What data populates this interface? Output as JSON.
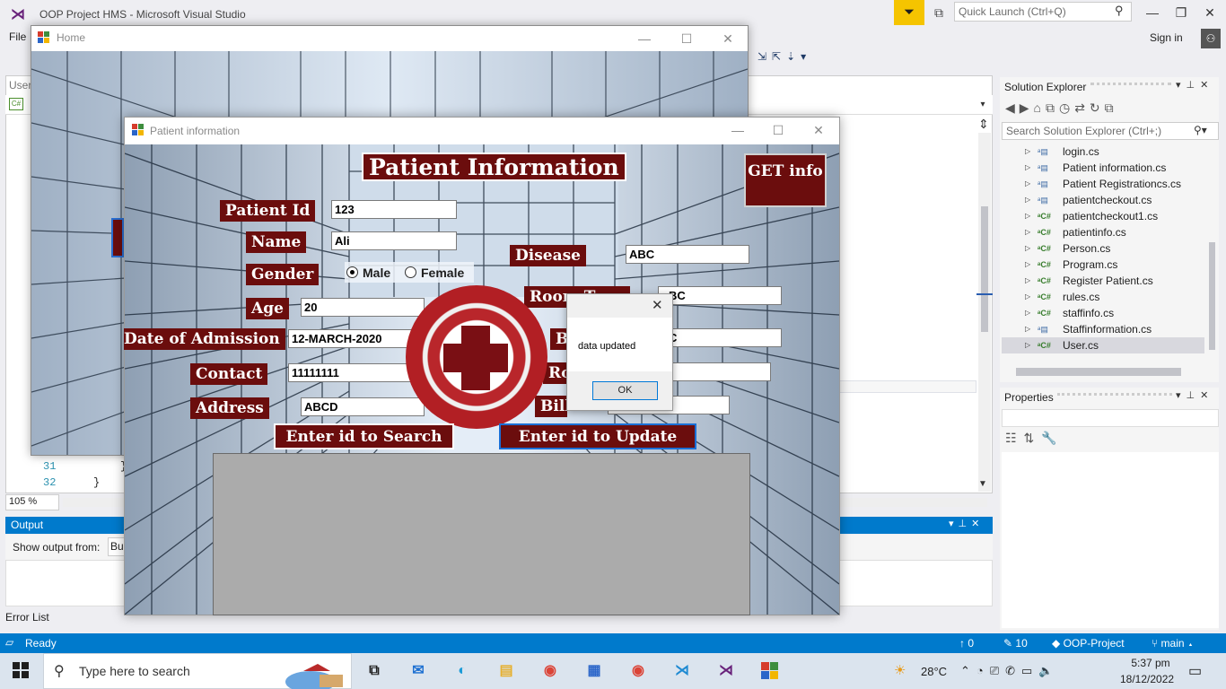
{
  "vs": {
    "logo": "⋊",
    "title": "OOP Project HMS - Microsoft Visual Studio",
    "menu_file": "File",
    "quick_launch_placeholder": "Quick Launch (Ctrl+Q)",
    "sign_in": "Sign in",
    "editor_tab": "User",
    "zoom": "105 %",
    "line_numbers": [
      "31",
      "32"
    ],
    "code_lines": [
      "}",
      "}"
    ],
    "output": {
      "title": "Output",
      "show_from_label": "Show output from:",
      "show_from_value": "Bu"
    },
    "error_list": "Error List",
    "status": {
      "ready": "Ready",
      "up_count": "0",
      "pencil_count": "10",
      "project": "OOP-Project",
      "branch": "main"
    }
  },
  "solution_explorer": {
    "title": "Solution Explorer",
    "search_placeholder": "Search Solution Explorer (Ctrl+;)",
    "items": [
      {
        "label": "login.cs",
        "kind": "form"
      },
      {
        "label": "Patient information.cs",
        "kind": "form"
      },
      {
        "label": "Patient Registrationcs.cs",
        "kind": "form"
      },
      {
        "label": "patientcheckout.cs",
        "kind": "form"
      },
      {
        "label": "patientcheckout1.cs",
        "kind": "cs"
      },
      {
        "label": "patientinfo.cs",
        "kind": "cs"
      },
      {
        "label": "Person.cs",
        "kind": "cs"
      },
      {
        "label": "Program.cs",
        "kind": "cs"
      },
      {
        "label": "Register Patient.cs",
        "kind": "cs"
      },
      {
        "label": "rules.cs",
        "kind": "cs"
      },
      {
        "label": "staffinfo.cs",
        "kind": "cs"
      },
      {
        "label": "Staffinformation.cs",
        "kind": "form"
      },
      {
        "label": "User.cs",
        "kind": "cs",
        "selected": true
      }
    ]
  },
  "properties": {
    "title": "Properties"
  },
  "home_window": {
    "title": "Home"
  },
  "patient_window": {
    "title": "Patient information",
    "heading": "Patient Information",
    "get_info": "GET info",
    "labels": {
      "patient_id": "Patient Id",
      "name": "Name",
      "gender": "Gender",
      "age": "Age",
      "date_of_admission": "Date of Admission",
      "contact": "Contact",
      "address": "Address",
      "disease": "Disease",
      "room": "Room Type",
      "bed": "Bed",
      "ro2": "Room",
      "bill": "Bill"
    },
    "values": {
      "patient_id": "123",
      "name": "Ali",
      "age": "20",
      "date_of_admission": "12-MARCH-2020",
      "contact": "11111111",
      "address": "ABCD",
      "disease": "ABC",
      "room": "BC",
      "bed": "C",
      "ro2": "",
      "bill": ""
    },
    "gender_options": {
      "male": "Male",
      "female": "Female",
      "selected": "Male"
    },
    "buttons": {
      "search": "Enter id to Search",
      "update": "Enter id to Update"
    }
  },
  "message_box": {
    "text": "data updated",
    "ok": "OK"
  },
  "taskbar": {
    "search_placeholder": "Type here to search",
    "temperature": "28°C",
    "time": "5:37 pm",
    "date": "18/12/2022"
  }
}
